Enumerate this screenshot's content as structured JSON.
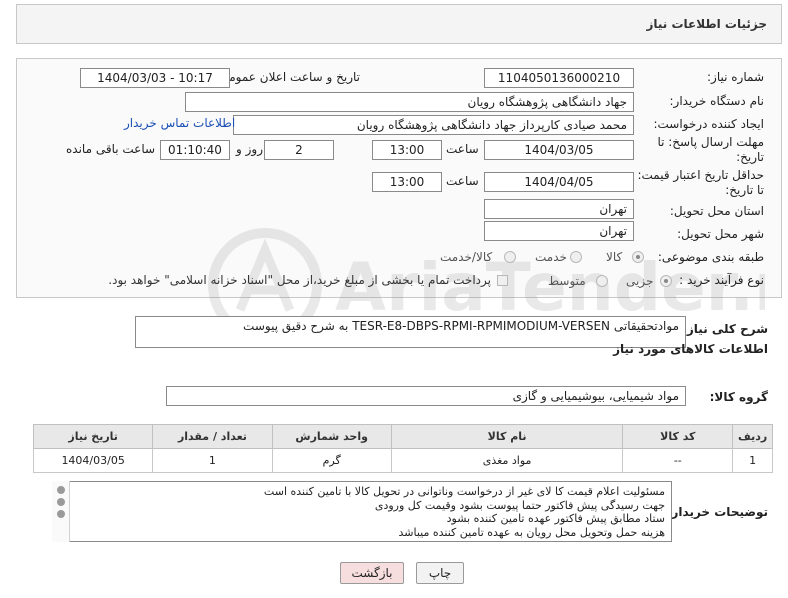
{
  "header": {
    "title": "جزئیات اطلاعات نیاز"
  },
  "form": {
    "need_number": {
      "label": "شماره نیاز:",
      "value": "1104050136000210"
    },
    "announce": {
      "label": "تاریخ و ساعت اعلان عمومی:",
      "value": "1404/03/03 - 10:17"
    },
    "buyer_org": {
      "label": "نام دستگاه خریدار:",
      "value": "جهاد دانشگاهی پژوهشگاه رویان"
    },
    "creator": {
      "label": "ایجاد کننده درخواست:",
      "value": "محمد صیادی کارپرداز جهاد دانشگاهی پژوهشگاه رویان",
      "contact_link": "اطلاعات تماس خریدار"
    },
    "reply_deadline": {
      "label_line1": "مهلت ارسال پاسخ: تا",
      "label_line2": "تاریخ:",
      "date": "1404/03/05",
      "time_label": "ساعت",
      "time": "13:00",
      "days": "2",
      "days_label": "روز و",
      "remaining": "01:10:40",
      "remaining_label": "ساعت باقی مانده"
    },
    "price_validity": {
      "label_line1": "حداقل تاریخ اعتبار قیمت:",
      "label_line2": "تا تاریخ:",
      "date": "1404/04/05",
      "time_label": "ساعت",
      "time": "13:00"
    },
    "delivery_province": {
      "label": "استان محل تحویل:",
      "value": "تهران"
    },
    "delivery_city": {
      "label": "شهر محل تحویل:",
      "value": "تهران"
    },
    "category": {
      "label": "طبقه بندی موضوعی:",
      "options": [
        "کالا",
        "خدمت",
        "کالا/خدمت"
      ],
      "selected": "کالا"
    },
    "process_type": {
      "label": "نوع فرآیند خرید :",
      "options": [
        "جزیی",
        "متوسط"
      ],
      "selected": "جزیی",
      "payment_note": "پرداخت تمام یا بخشی از مبلغ خرید،از محل \"اسناد خزانه اسلامی\" خواهد بود."
    }
  },
  "description": {
    "label": "شرح کلی نیاز:",
    "value": "موادتحقیقاتی TESR-E8-DBPS-RPMI-RPMIMODIUM-VERSEN  به شرح دقیق پیوست"
  },
  "goods_section": {
    "title": "اطلاعات کالاهای مورد نیاز",
    "group_label": "گروه کالا:",
    "group_value": "مواد شیمیایی، بیوشیمیایی و  گازی"
  },
  "goods_table": {
    "headers": [
      "ردیف",
      "کد کالا",
      "نام کالا",
      "واحد شمارش",
      "تعداد / مقدار",
      "تاریخ نیاز"
    ],
    "rows": [
      [
        "1",
        "--",
        "مواد مغذی",
        "گرم",
        "1",
        "1404/03/05"
      ]
    ]
  },
  "buyer_notes": {
    "label": "توضیحات خریدار:",
    "lines": [
      "مسئولیت اعلام قیمت کا لای  غیر از درخواست وناتوانی در تحویل کالا با تامین کننده است",
      "جهت رسیدگی پیش فاکتور حتما پیوست بشود وقیمت کل ورودی",
      "ستاد مطابق پیش فاکتور عهده تامین کننده بشود",
      "هزینه حمل وتحویل محل رویان به عهده تامین کننده میباشد"
    ]
  },
  "buttons": {
    "print": "چاپ",
    "back": "بازگشت"
  },
  "watermark": {
    "text": "AriaTender.neT"
  },
  "colors": {
    "link": "#1a4fb5",
    "back_button_bg": "#f7dede",
    "panel_bg": "#fafafa"
  }
}
